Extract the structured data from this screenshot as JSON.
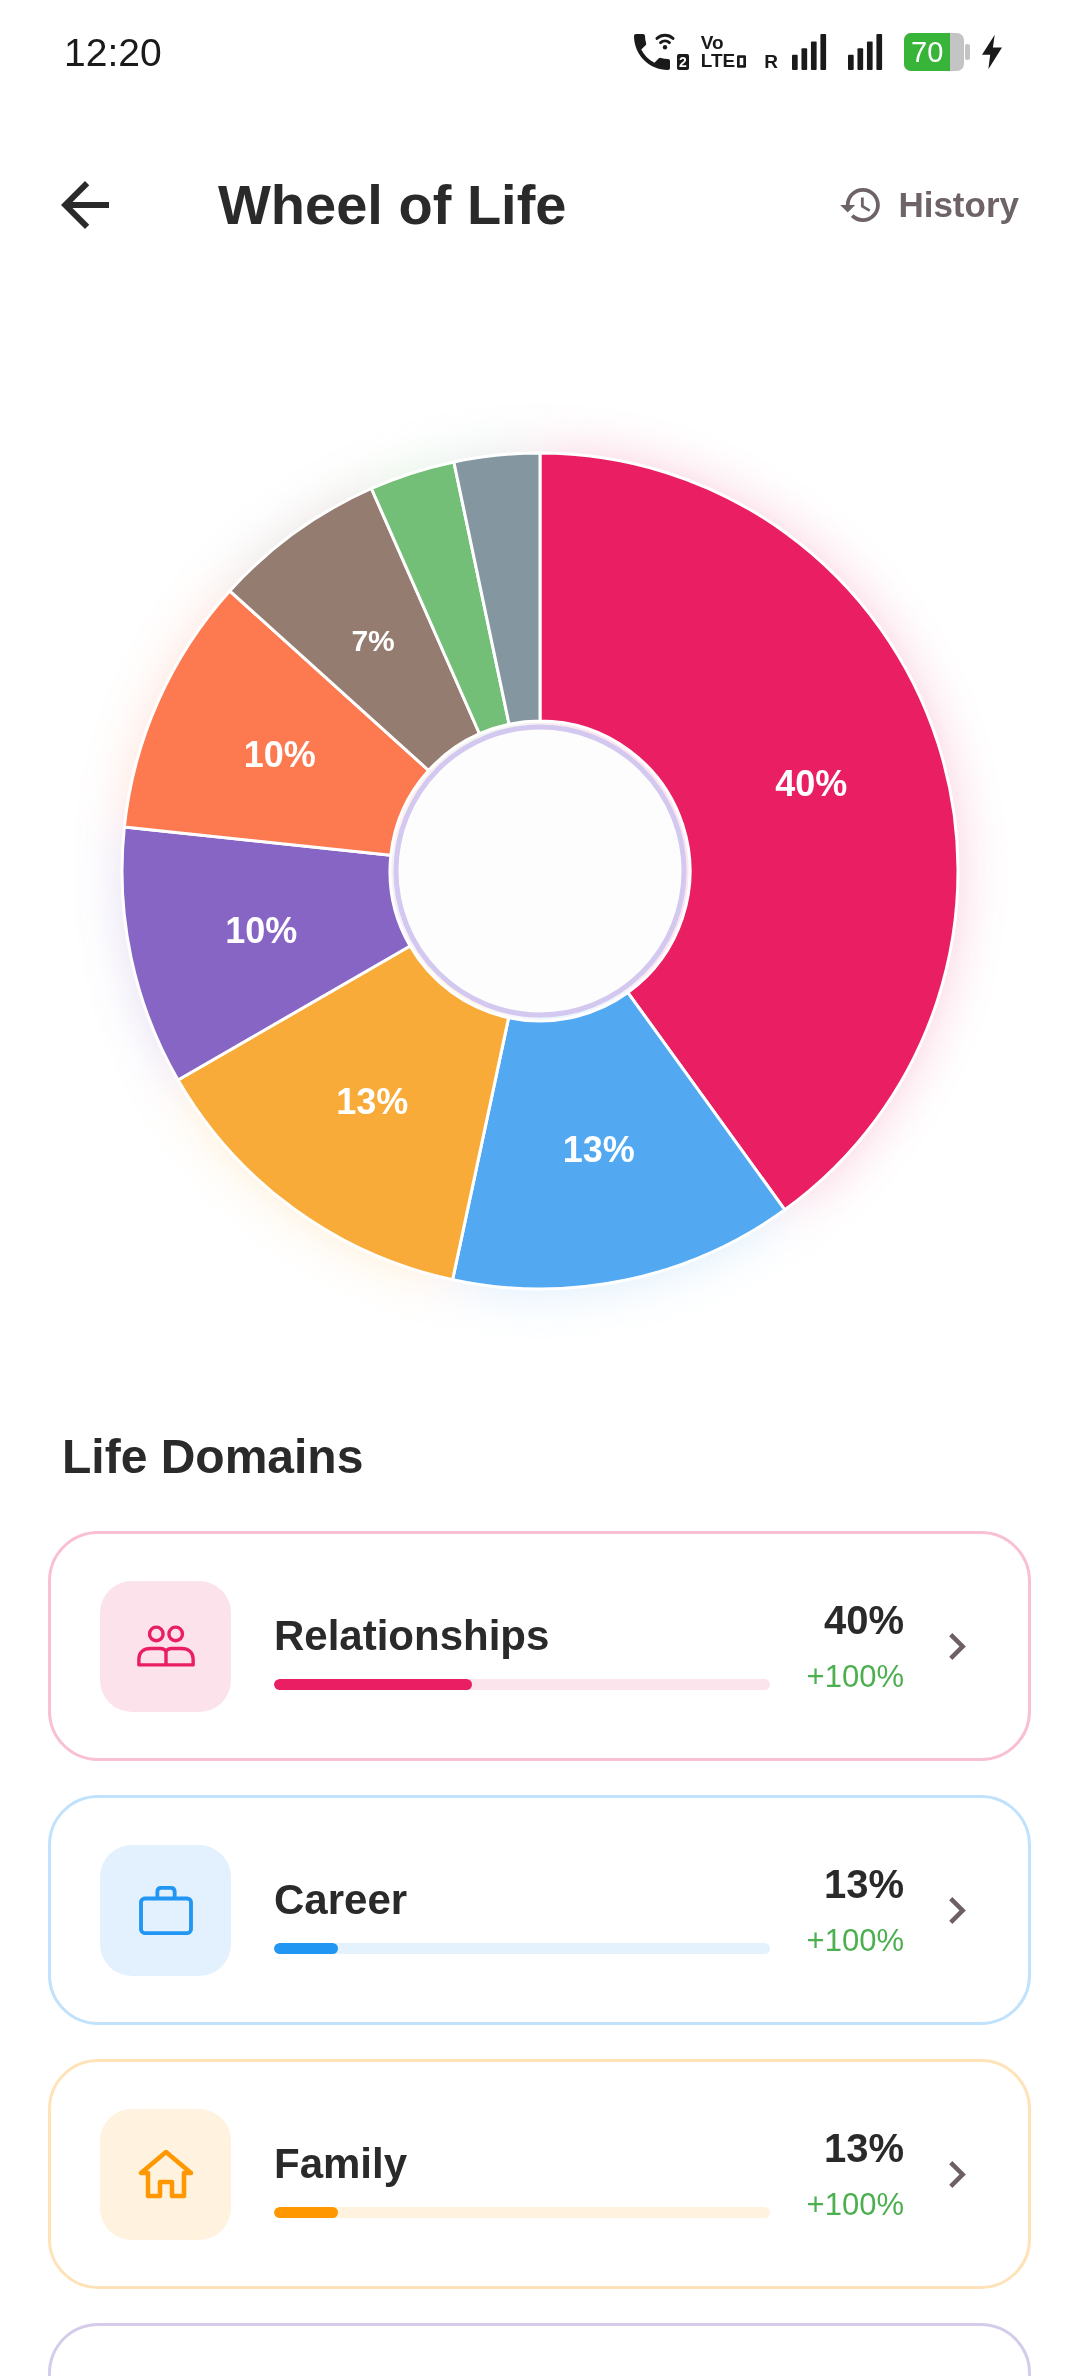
{
  "status_bar": {
    "time": "12:20",
    "sim_badge": "2",
    "volte_top": "Vo",
    "volte_bottom": "LTE",
    "roaming": "R",
    "battery_text": "70"
  },
  "header": {
    "title": "Wheel of Life",
    "history_label": "History"
  },
  "chart": {
    "chart_data": {
      "type": "donut",
      "values": [
        40,
        13.3,
        13.3,
        10,
        10,
        6.7,
        3.3,
        3.3
      ],
      "colors": [
        "#e91e63",
        "#52a9f2",
        "#f9ab3a",
        "#8765c4",
        "#fd7a50",
        "#957c71",
        "#74bf77",
        "#8497a1"
      ],
      "value_labels": [
        "40%",
        "13%",
        "13%",
        "10%",
        "10%",
        "7%",
        null,
        null
      ]
    }
  },
  "domains": {
    "title": "Life Domains",
    "items": [
      {
        "name": "Relationships",
        "color": "#e91e63",
        "level": 0.4,
        "percent": "40%",
        "change": "+100%"
      },
      {
        "name": "Career",
        "color": "#2196f3",
        "level": 0.13,
        "percent": "13%",
        "change": "+100%"
      },
      {
        "name": "Family",
        "color": "#ff9800",
        "level": 0.13,
        "percent": "13%",
        "change": "+100%"
      },
      {
        "color": "#d5cbea"
      }
    ]
  }
}
